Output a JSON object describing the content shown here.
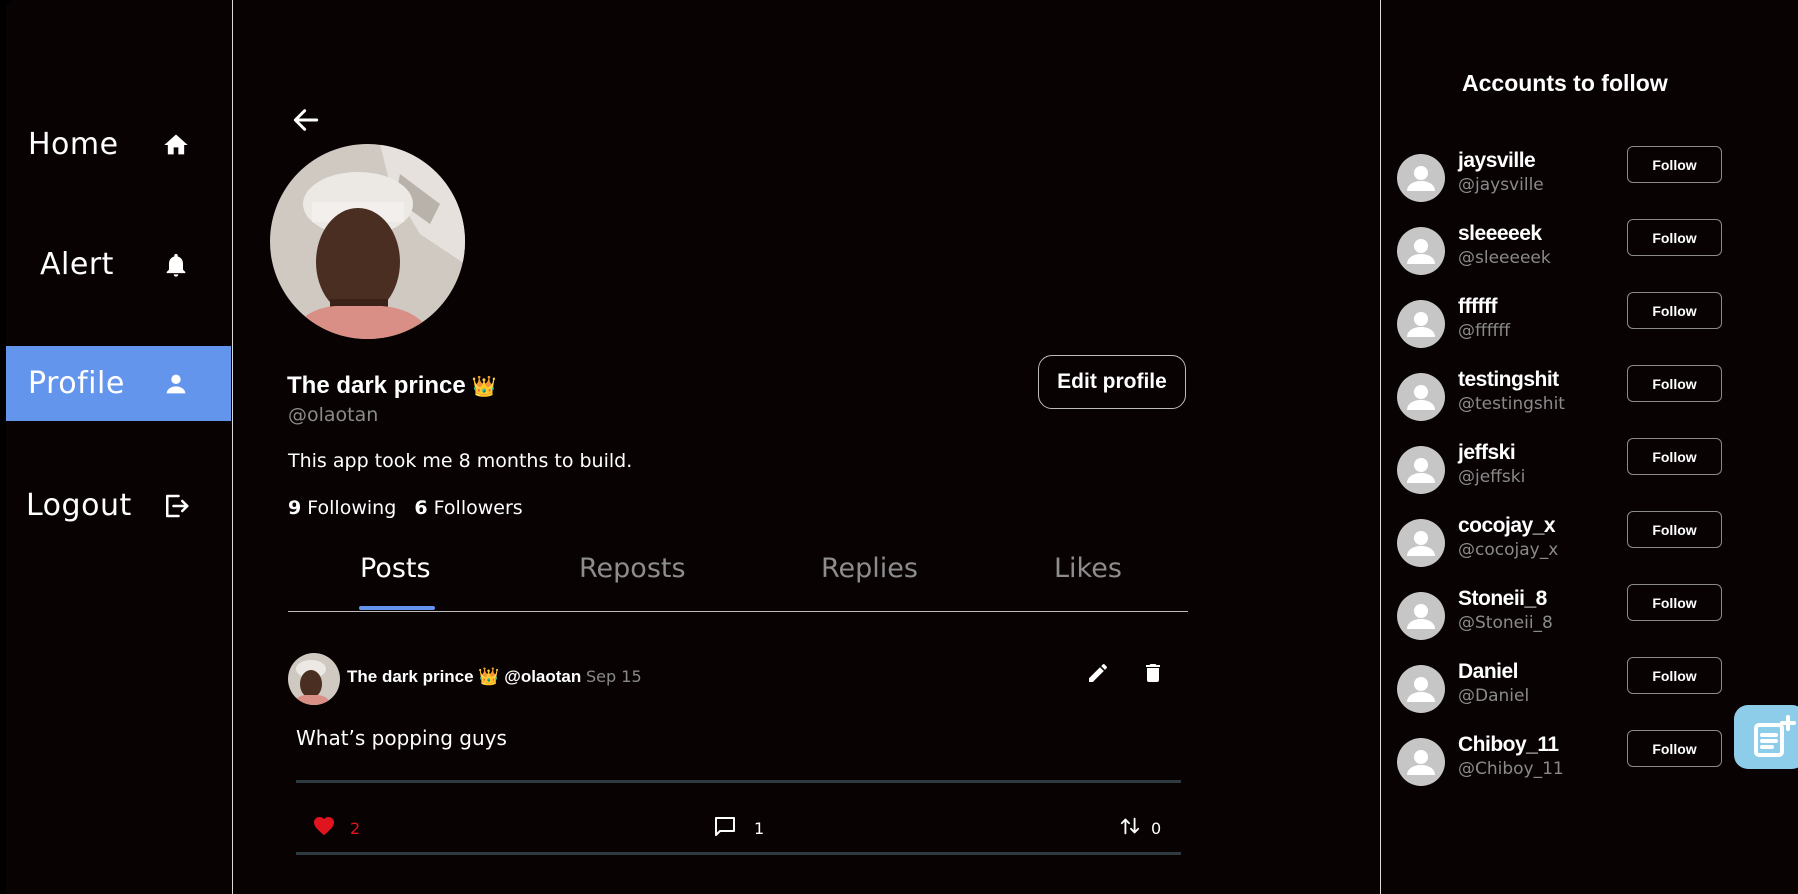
{
  "nav": {
    "items": [
      {
        "label": "Home",
        "icon": "home-icon"
      },
      {
        "label": "Alert",
        "icon": "bell-icon"
      },
      {
        "label": "Profile",
        "icon": "person-icon",
        "active": true
      },
      {
        "label": "Logout",
        "icon": "logout-icon"
      }
    ]
  },
  "profile": {
    "display_name": "The dark prince",
    "crown": "👑",
    "handle": "@olaotan",
    "bio": "This app took me 8 months to build.",
    "following_count": "9",
    "following_label": "Following",
    "followers_count": "6",
    "followers_label": "Followers",
    "edit_label": "Edit profile"
  },
  "tabs": [
    "Posts",
    "Reposts",
    "Replies",
    "Likes"
  ],
  "active_tab": "Posts",
  "post": {
    "author": "The dark prince",
    "crown": "👑",
    "handle": "@olaotan",
    "date": "Sep 15",
    "text": "What’s popping guys",
    "likes": "2",
    "comments": "1",
    "reposts": "0"
  },
  "suggestions": {
    "title": "Accounts to follow",
    "follow_label": "Follow",
    "accounts": [
      {
        "name": "jaysville",
        "handle": "@jaysville"
      },
      {
        "name": "sleeeeek",
        "handle": "@sleeeeek"
      },
      {
        "name": "ffffff",
        "handle": "@ffffff"
      },
      {
        "name": "testingshit",
        "handle": "@testingshit"
      },
      {
        "name": "jeffski",
        "handle": "@jeffski"
      },
      {
        "name": "cocojay_x",
        "handle": "@cocojay_x"
      },
      {
        "name": "Stoneii_8",
        "handle": "@Stoneii_8"
      },
      {
        "name": "Daniel",
        "handle": "@Daniel"
      },
      {
        "name": "Chiboy_11",
        "handle": "@Chiboy_11"
      }
    ]
  },
  "colors": {
    "background": "#080203",
    "accent": "#6495ed",
    "like": "#e0141e",
    "fab": "#8ecde9"
  }
}
